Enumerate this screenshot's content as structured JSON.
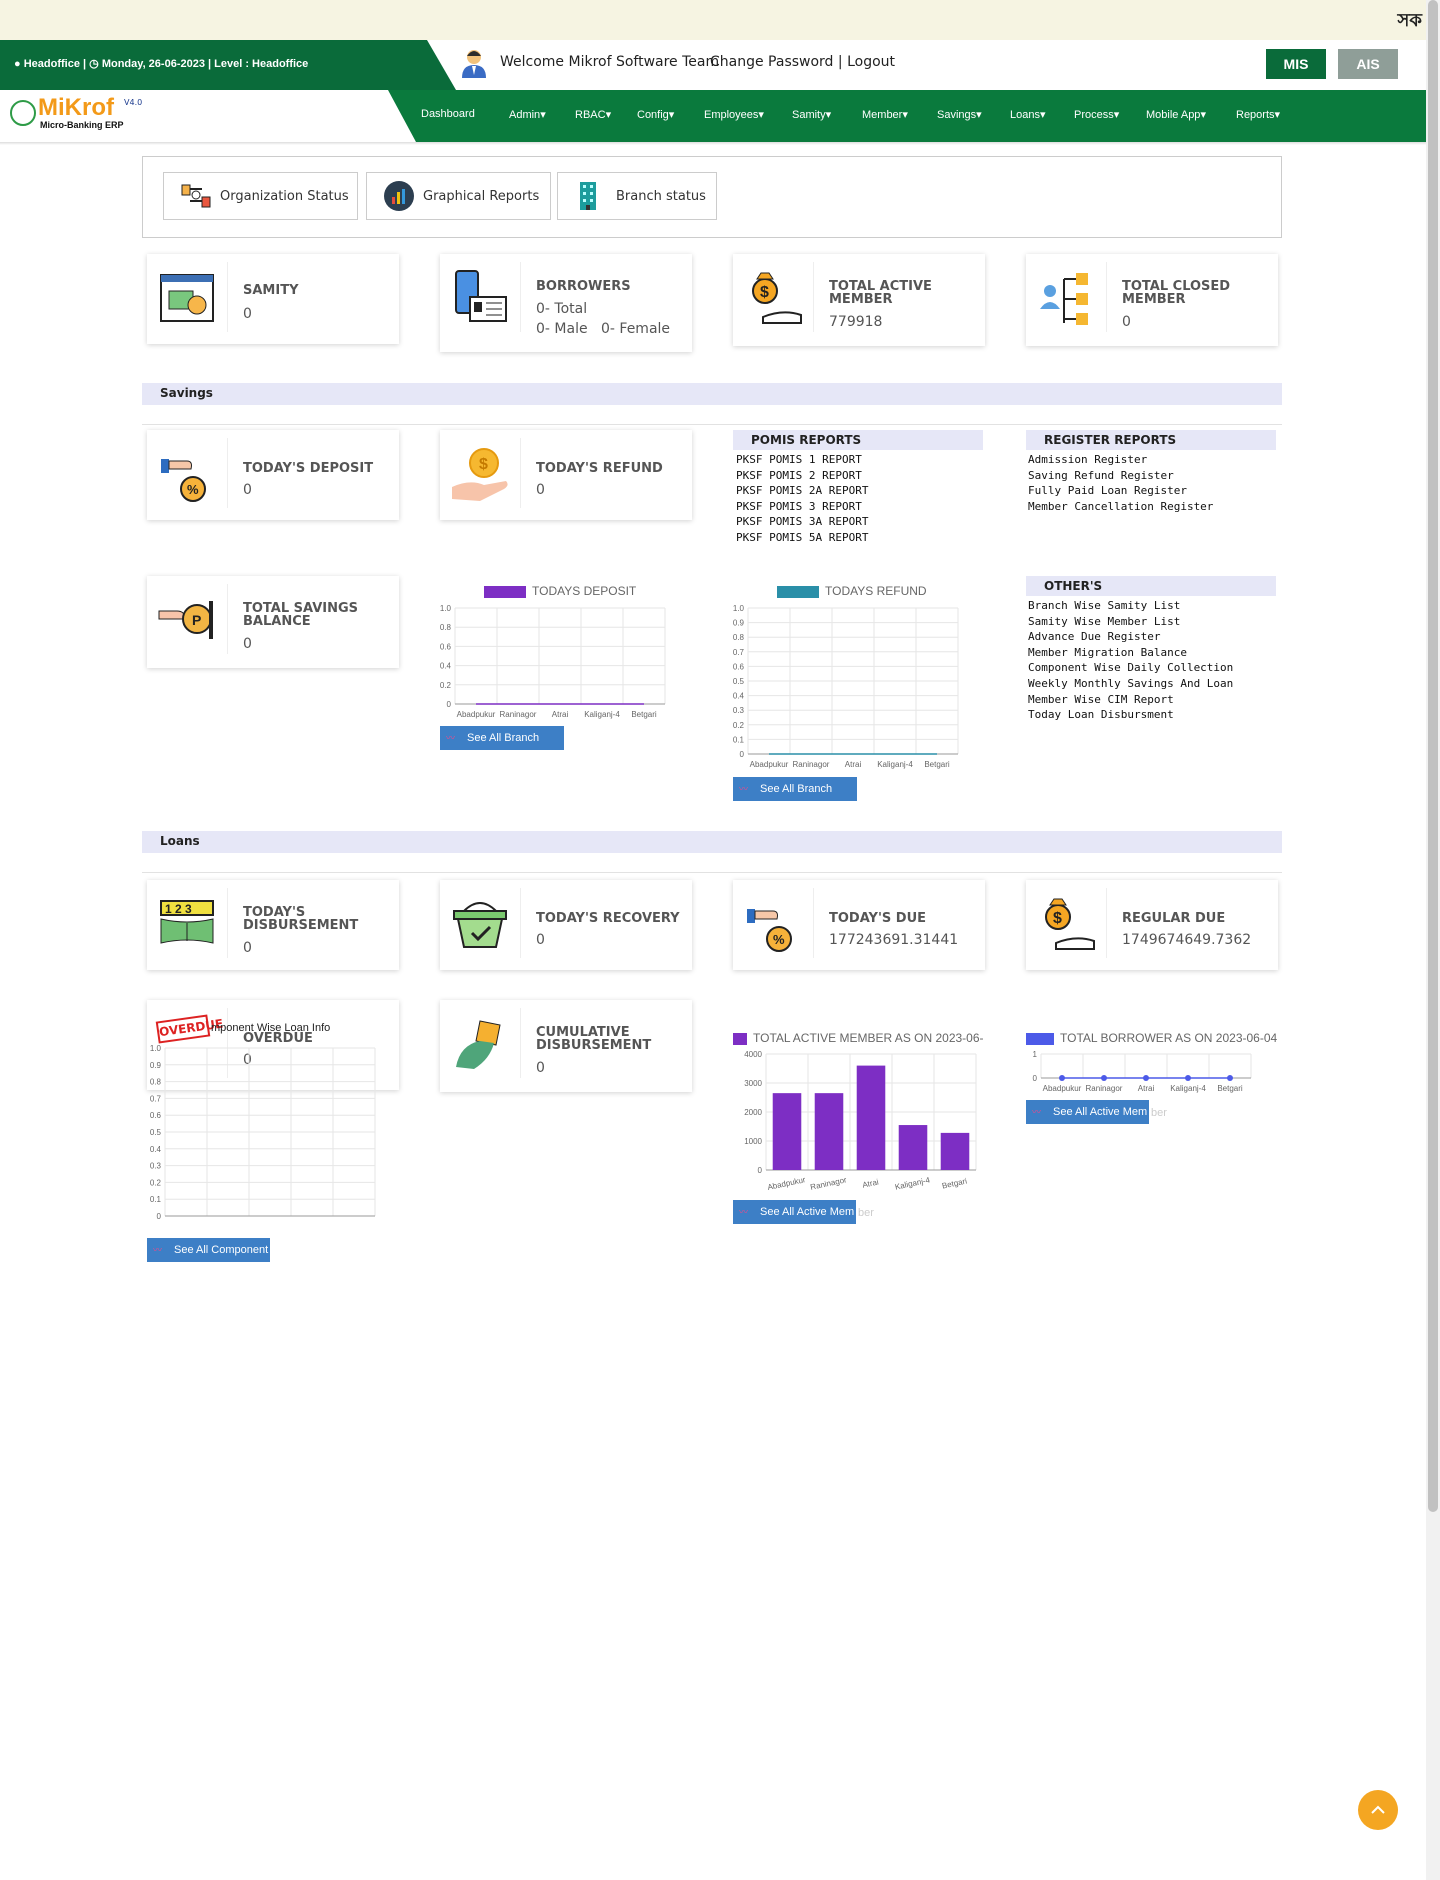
{
  "top_strip": {
    "text": "সক"
  },
  "header": {
    "info_office": "Headoffice |",
    "info_date": "Monday, 26-06-2023 |",
    "info_level": "Level : Headoffice",
    "welcome": "Welcome Mikrof Software Team",
    "change_password": "Change Password",
    "link_sep": "|",
    "logout": "Logout",
    "mis": "MIS",
    "ais": "AIS"
  },
  "brand": {
    "name": "MiKrof",
    "version": "V4.0",
    "tagline": "Micro-Banking ERP"
  },
  "nav": [
    "Dashboard",
    "Admin",
    "RBAC",
    "Config",
    "Employees",
    "Samity",
    "Member",
    "Savings",
    "Loans",
    "Process",
    "Mobile App",
    "Reports"
  ],
  "tabs": [
    "Organization Status",
    "Graphical Reports",
    "Branch status"
  ],
  "stats": {
    "samity": {
      "title": "SAMITY",
      "value": "0"
    },
    "borrowers": {
      "title": "BORROWERS",
      "total": "0- Total",
      "male": "0- Male",
      "female": "0- Female"
    },
    "active_member": {
      "title_1": "TOTAL ACTIVE",
      "title_2": "MEMBER",
      "value": "779918"
    },
    "closed_member": {
      "title_1": "TOTAL CLOSED",
      "title_2": "MEMBER",
      "value": "0"
    }
  },
  "savings": {
    "section": "Savings",
    "todays_deposit": {
      "title": "TODAY'S DEPOSIT",
      "value": "0"
    },
    "todays_refund": {
      "title": "TODAY'S REFUND",
      "value": "0"
    },
    "total_savings": {
      "title_1": "TOTAL SAVINGS",
      "title_2": "BALANCE",
      "value": "0"
    },
    "pomis_title": "POMIS REPORTS",
    "pomis": [
      "PKSF POMIS 1 REPORT",
      "PKSF POMIS 2 REPORT",
      "PKSF POMIS 2A REPORT",
      "PKSF POMIS 3 REPORT",
      "PKSF POMIS 3A REPORT",
      "PKSF POMIS 5A REPORT"
    ],
    "register_title": "REGISTER REPORTS",
    "registers": [
      "Admission Register",
      "Saving Refund Register",
      "Fully Paid Loan Register",
      "Member Cancellation Register"
    ],
    "others_title": "OTHER'S",
    "others": [
      "Branch Wise Samity List",
      "Samity Wise Member List",
      "Advance Due Register",
      "Member Migration Balance",
      "Component Wise Daily Collection",
      "Weekly Monthly Savings And Loan",
      "Member Wise CIM Report",
      "Today Loan Disbursment"
    ],
    "see_all_branch": "See All Branch"
  },
  "loans": {
    "section": "Loans",
    "disbursement": {
      "title_1": "TODAY'S",
      "title_2": "DISBURSEMENT",
      "value": "0"
    },
    "recovery": {
      "title": "TODAY'S RECOVERY",
      "value": "0"
    },
    "due": {
      "title": "TODAY'S DUE",
      "value": "177243691.31441"
    },
    "regular_due": {
      "title": "REGULAR DUE",
      "value": "1749674649.7362"
    },
    "overdue": {
      "title": "OVERDUE",
      "value": "0",
      "stamp": "OVERDUE",
      "chart_caption": "mponent Wise Loan Info"
    },
    "cumulative": {
      "title_1": "CUMULATIVE",
      "title_2": "DISBURSEMENT",
      "value": "0"
    },
    "see_all_component": "See All Component",
    "see_all_active_member": "See All Active Mem",
    "see_all_active_member_faded": "ber"
  },
  "chart_data": [
    {
      "type": "line",
      "title": "TODAYS DEPOSIT",
      "series": [
        {
          "name": "TODAYS DEPOSIT",
          "values": [
            0,
            0,
            0,
            0,
            0
          ]
        }
      ],
      "categories": [
        "Abadpukur",
        "Raninagor",
        "Atrai",
        "Kaliganj-4",
        "Betgari"
      ],
      "ylim": [
        0,
        1.0
      ],
      "yticks": [
        "1.0",
        "0.8",
        "0.6",
        "0.4",
        "0.2",
        "0"
      ],
      "color": "#7d2ec4",
      "grid": true
    },
    {
      "type": "line",
      "title": "TODAYS REFUND",
      "series": [
        {
          "name": "TODAYS REFUND",
          "values": [
            0,
            0,
            0,
            0,
            0
          ]
        }
      ],
      "categories": [
        "Abadpukur",
        "Raninagor",
        "Atrai",
        "Kaliganj-4",
        "Betgari"
      ],
      "ylim": [
        0,
        1.0
      ],
      "yticks": [
        "1.0",
        "0.9",
        "0.8",
        "0.7",
        "0.6",
        "0.5",
        "0.4",
        "0.3",
        "0.2",
        "0.1",
        "0"
      ],
      "color": "#2a8fa8",
      "grid": true
    },
    {
      "type": "line",
      "title": "",
      "series": [
        {
          "values": []
        }
      ],
      "categories": [],
      "ylim": [
        0,
        1.0
      ],
      "yticks": [
        "1.0",
        "0.9",
        "0.8",
        "0.7",
        "0.6",
        "0.5",
        "0.4",
        "0.3",
        "0.2",
        "0.1",
        "0"
      ],
      "grid": true
    },
    {
      "type": "bar",
      "title": "TOTAL ACTIVE MEMBER AS ON 2023-06-",
      "series": [
        {
          "name": "TOTAL ACTIVE MEMBER AS ON 2023-06-",
          "values": [
            2650,
            2650,
            3600,
            1550,
            1280
          ]
        }
      ],
      "categories": [
        "Abadpukur",
        "Raninagor",
        "Atrai",
        "Kaliganj-4",
        "Betgari"
      ],
      "ylim": [
        0,
        4000
      ],
      "yticks": [
        "4000",
        "3000",
        "2000",
        "1000",
        "0"
      ],
      "color": "#7d2ec4",
      "grid": true
    },
    {
      "type": "line",
      "title": "TOTAL BORROWER AS ON 2023-06-04",
      "series": [
        {
          "name": "TOTAL BORROWER AS ON 2023-06-04",
          "values": [
            0,
            0,
            0,
            0,
            0
          ]
        }
      ],
      "categories": [
        "Abadpukur",
        "Raninagor",
        "Atrai",
        "Kaliganj-4",
        "Betgari"
      ],
      "ylim": [
        0,
        1
      ],
      "yticks": [
        "1",
        "0"
      ],
      "color": "#4c5ae8",
      "grid": true
    }
  ]
}
